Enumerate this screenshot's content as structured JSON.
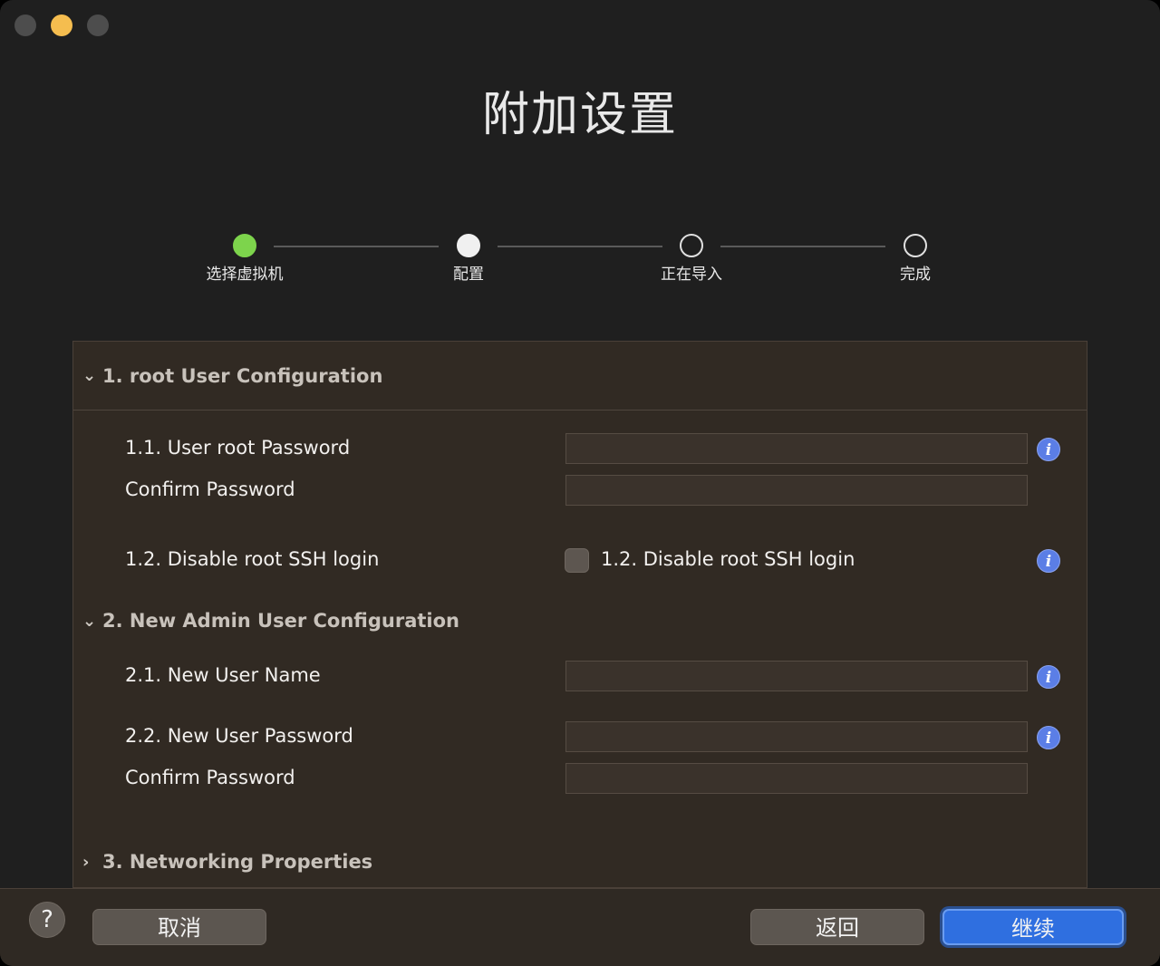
{
  "window": {
    "traffic_lights": [
      "close",
      "minimize",
      "maximize"
    ],
    "title": "附加设置"
  },
  "stepper": {
    "steps": [
      {
        "label": "选择虚拟机",
        "state": "done"
      },
      {
        "label": "配置",
        "state": "current"
      },
      {
        "label": "正在导入",
        "state": "pending"
      },
      {
        "label": "完成",
        "state": "pending"
      }
    ]
  },
  "sections": {
    "root_config": {
      "title": "1. root User Configuration",
      "expanded": true,
      "rows": {
        "root_password_label": "1.1. User root Password",
        "root_password_value": "",
        "root_confirm_label": "Confirm Password",
        "root_confirm_value": "",
        "disable_ssh_label": "1.2. Disable root SSH login",
        "disable_ssh_checkbox_label": "1.2. Disable root SSH login",
        "disable_ssh_checked": false
      }
    },
    "admin_config": {
      "title": "2. New Admin User Configuration",
      "expanded": true,
      "rows": {
        "user_name_label": "2.1. New User Name",
        "user_name_value": "",
        "user_password_label": "2.2. New User Password",
        "user_password_value": "",
        "user_confirm_label": "Confirm Password",
        "user_confirm_value": ""
      }
    },
    "networking": {
      "title": "3. Networking Properties",
      "expanded": false
    }
  },
  "icons": {
    "chevron_expanded": "⌄",
    "chevron_collapsed": "›",
    "info": "i",
    "help": "?"
  },
  "footer": {
    "cancel_label": "取消",
    "back_label": "返回",
    "continue_label": "继续"
  },
  "colors": {
    "step_done": "#7dd44c",
    "primary_button": "#2f6fe0",
    "info_icon": "#5b7ee6",
    "panel_bg": "#312a23"
  }
}
